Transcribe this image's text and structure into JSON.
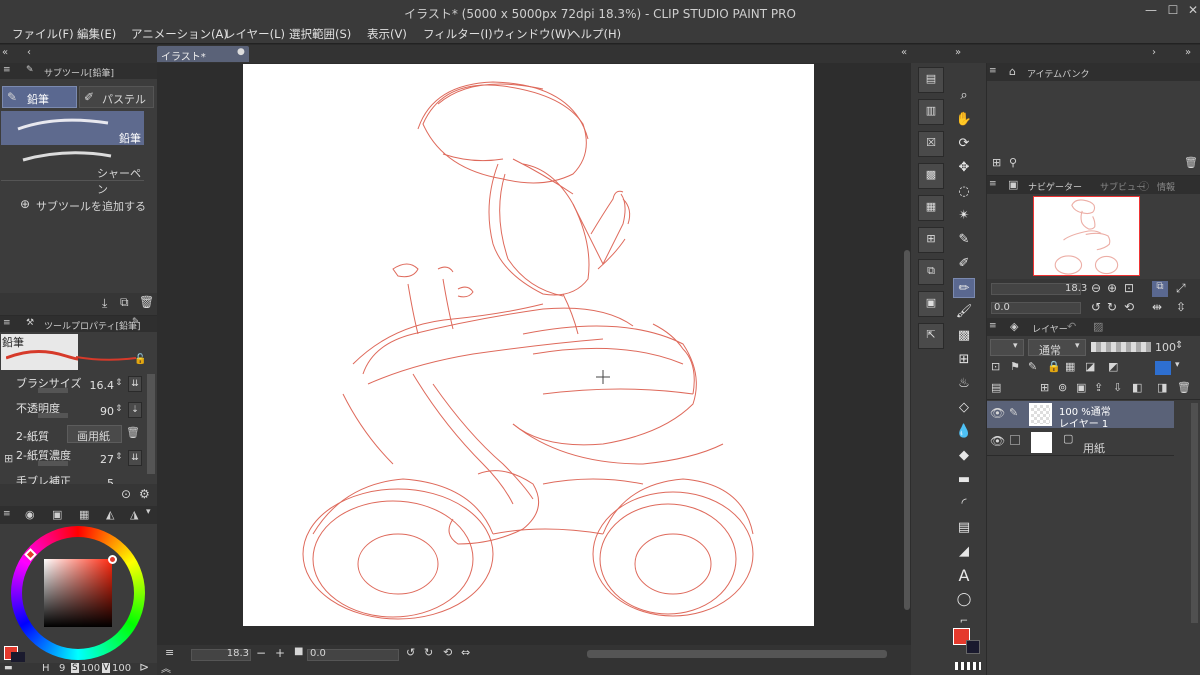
{
  "window": {
    "title": "イラスト* (5000 x 5000px 72dpi 18.3%)  - CLIP STUDIO PAINT PRO",
    "min": "—",
    "max": "☐",
    "close": "✕"
  },
  "menu": [
    "ファイル(F)",
    "編集(E)",
    "アニメーション(A)",
    "レイヤー(L)",
    "選択範囲(S)",
    "表示(V)",
    "フィルター(I)",
    "ウィンドウ(W)",
    "ヘルプ(H)"
  ],
  "canvas_tab": {
    "label": "イラスト*"
  },
  "subtool": {
    "title": "サブツール[鉛筆]",
    "tab1": "鉛筆",
    "tab2": "パステル",
    "items": [
      "鉛筆",
      "シャーペン"
    ],
    "add": "サブツールを追加する"
  },
  "toolprop": {
    "title": "ツールプロパティ[鉛筆]",
    "preview": "鉛筆",
    "rows": [
      {
        "label": "ブラシサイズ",
        "value": "16.4"
      },
      {
        "label": "不透明度",
        "value": "90"
      },
      {
        "label": "2-紙質",
        "value": "画用紙"
      },
      {
        "label": "2-紙質濃度",
        "value": "27"
      },
      {
        "label": "手ブレ補正",
        "value": "5"
      }
    ]
  },
  "color": {
    "main": "#e53a2d",
    "sub": "#1a1a2e",
    "h_label": "H",
    "h": "9",
    "s_label": "S",
    "s": "100",
    "v_label": "V",
    "v": "100"
  },
  "status": {
    "zoom": "18.3",
    "rotate": "0.0"
  },
  "tool_icons": [
    "zoom-icon",
    "hand-icon",
    "rotate-icon",
    "move-icon",
    "lasso-icon",
    "magic-wand-icon",
    "eyedropper-icon",
    "dropper-icon",
    "pen-icon",
    "pencil-icon",
    "brush-icon",
    "decoration-icon",
    "eraser-icon",
    "blend-icon",
    "fill-icon",
    "gradient-icon",
    "figure-icon",
    "frame-icon",
    "ruler-icon",
    "text-icon",
    "balloon-icon",
    "correct-line-icon"
  ],
  "item_bank": {
    "title": "アイテムバンク"
  },
  "navigator": {
    "tab1": "ナビゲーター",
    "tab2": "サブビュー",
    "tab3": "情報",
    "zoom": "18.3",
    "angle": "0.0"
  },
  "layer": {
    "title": "レイヤー",
    "blend": "通常",
    "opacity": "100",
    "layers": [
      {
        "line1": "100 %通常",
        "line2": "レイヤー 1"
      },
      {
        "line1": "用紙",
        "line2": ""
      }
    ]
  }
}
